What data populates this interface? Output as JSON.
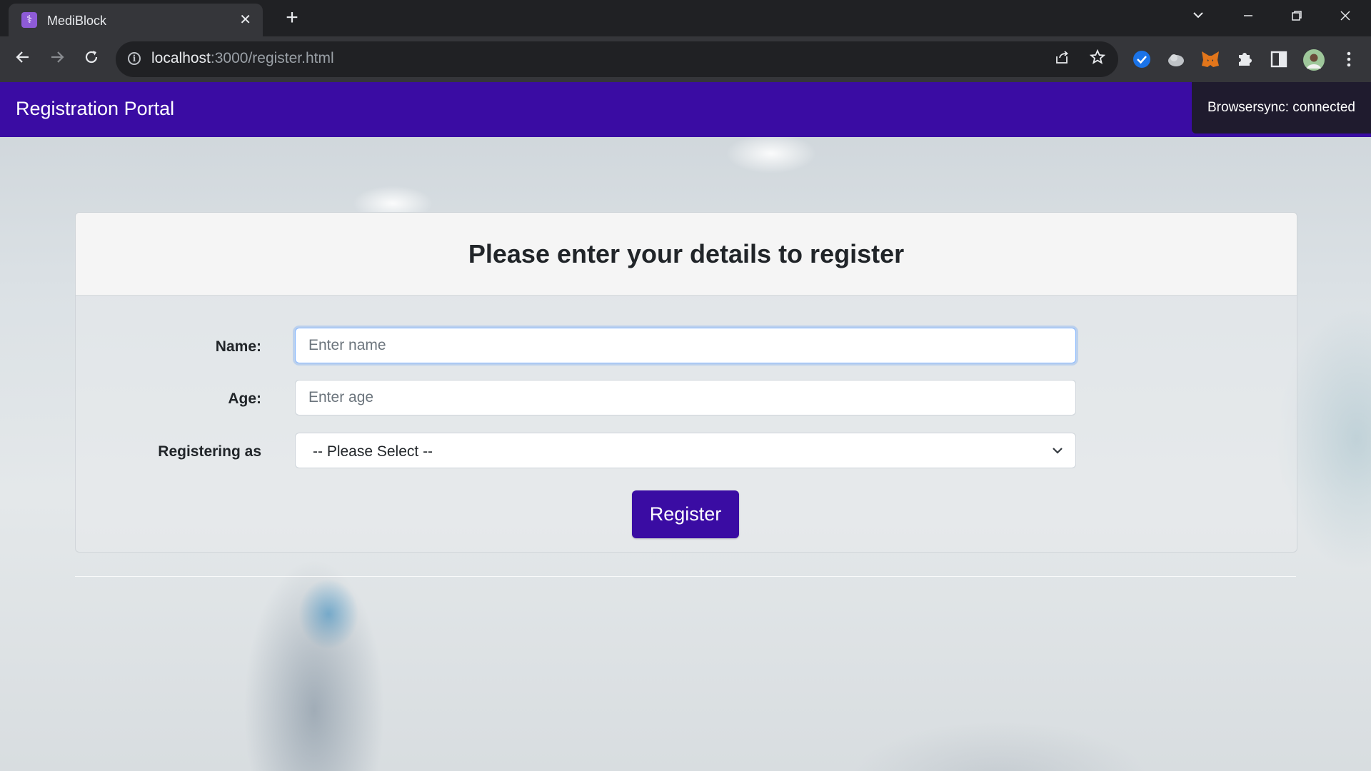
{
  "browser": {
    "tab_title": "MediBlock",
    "url_host": "localhost",
    "url_rest": ":3000/register.html"
  },
  "navbar": {
    "brand": "Registration Portal"
  },
  "browsersync": {
    "text": "Browsersync: connected"
  },
  "form": {
    "heading": "Please enter your details to register",
    "name_label": "Name:",
    "name_placeholder": "Enter name",
    "age_label": "Age:",
    "age_placeholder": "Enter age",
    "role_label": "Registering as",
    "role_selected": "-- Please Select --",
    "submit_label": "Register"
  },
  "colors": {
    "brand": "#3a0ca3",
    "browsersync_bg": "#1f1b2e"
  }
}
